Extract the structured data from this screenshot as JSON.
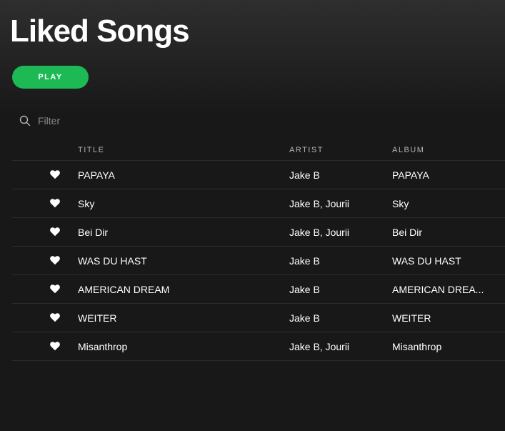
{
  "page": {
    "title": "Liked Songs",
    "accent_color": "#1db954"
  },
  "play_button": {
    "label": "PLAY"
  },
  "filter": {
    "placeholder": "Filter",
    "icon": "search-icon"
  },
  "table": {
    "columns": {
      "title": "TITLE",
      "artist": "ARTIST",
      "album": "ALBUM"
    },
    "like_icon": "heart-icon",
    "rows": [
      {
        "title": "PAPAYA",
        "artist": "Jake B",
        "album": "PAPAYA"
      },
      {
        "title": "Sky",
        "artist": "Jake B, Jourii",
        "album": "Sky"
      },
      {
        "title": "Bei Dir",
        "artist": "Jake B, Jourii",
        "album": "Bei Dir"
      },
      {
        "title": "WAS DU HAST",
        "artist": "Jake B",
        "album": "WAS DU HAST"
      },
      {
        "title": "AMERICAN DREAM",
        "artist": "Jake B",
        "album": "AMERICAN DREA..."
      },
      {
        "title": "WEITER",
        "artist": "Jake B",
        "album": "WEITER"
      },
      {
        "title": "Misanthrop",
        "artist": "Jake B, Jourii",
        "album": "Misanthrop"
      }
    ]
  }
}
